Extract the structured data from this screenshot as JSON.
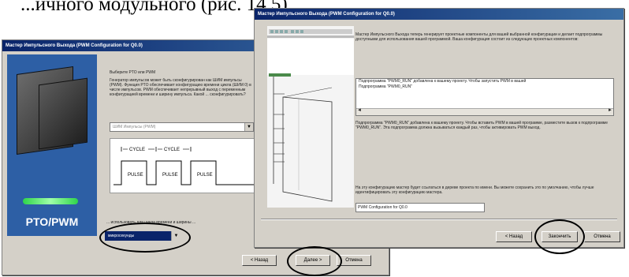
{
  "background_text": "...ичного модульного (рис. 14.5).",
  "dialog_back": {
    "title": "Мастер Импульсного Выхода (PWM Configuration for Q0.0)",
    "banner_label": "PTO/PWM",
    "heading": "Выберите PTO или PWM",
    "description": "Генератор импульсов может быть сконфигурирован как ШИМ импульсы (PWM). Функция PTO обеспечивает конфигурацию времени цикла (ШИМ 0) в числе импульсов. PWM обеспечивает непрерывный выход с переменным конфигурацией времени и ширину импульса. Какой ... сконфигурировать?",
    "mode_value": "ШИМ Импульсы (PWM)",
    "diagram": {
      "cycle": "CYCLE",
      "pulse": "PULSE"
    },
    "timebase_prompt": "... использовать для цикла времени и ширины ...",
    "timebase_value": "микросекунды",
    "buttons": {
      "back": "< Назад",
      "next": "Далее >",
      "cancel": "Отмена"
    }
  },
  "dialog_front": {
    "title": "Мастер Импульсного Выхода (PWM Configuration for Q0.0)",
    "intro": "Мастер Импульсного Выхода теперь генерирует проектные компоненты для вашей выбранной конфигурации и делает подпрограммы доступными для использования вашей программой. Ваша конфигурация состоит из следующих проектных компонентов:",
    "list_items": [
      "Подпрограмма \"PWM0_RUN\" добавлена к вашему проекту. Чтобы запустить PWM в вашей",
      "Подпрограмма \"PWM0_RUN\""
    ],
    "info": "Подпрограмма \"PWM0_RUN\" добавлена к вашему проекту. Чтобы вставить PWM в вашей программе, разместите вызов к подпрограмме \"PWM0_RUN\". Эта подпрограмма должна вызываться каждый раз, чтобы активировать PWM выход.",
    "comment_prompt": "На эту конфигурацию мастер будет ссылаться в дереве проекта по имени. Вы можете сохранить это по умолчанию, чтобы лучше идентифицировать эту конфигурацию мастера.",
    "config_name": "PWM Configuration for Q0.0",
    "buttons": {
      "back": "< Назад",
      "finish": "Закончить",
      "cancel": "Отмена"
    }
  }
}
